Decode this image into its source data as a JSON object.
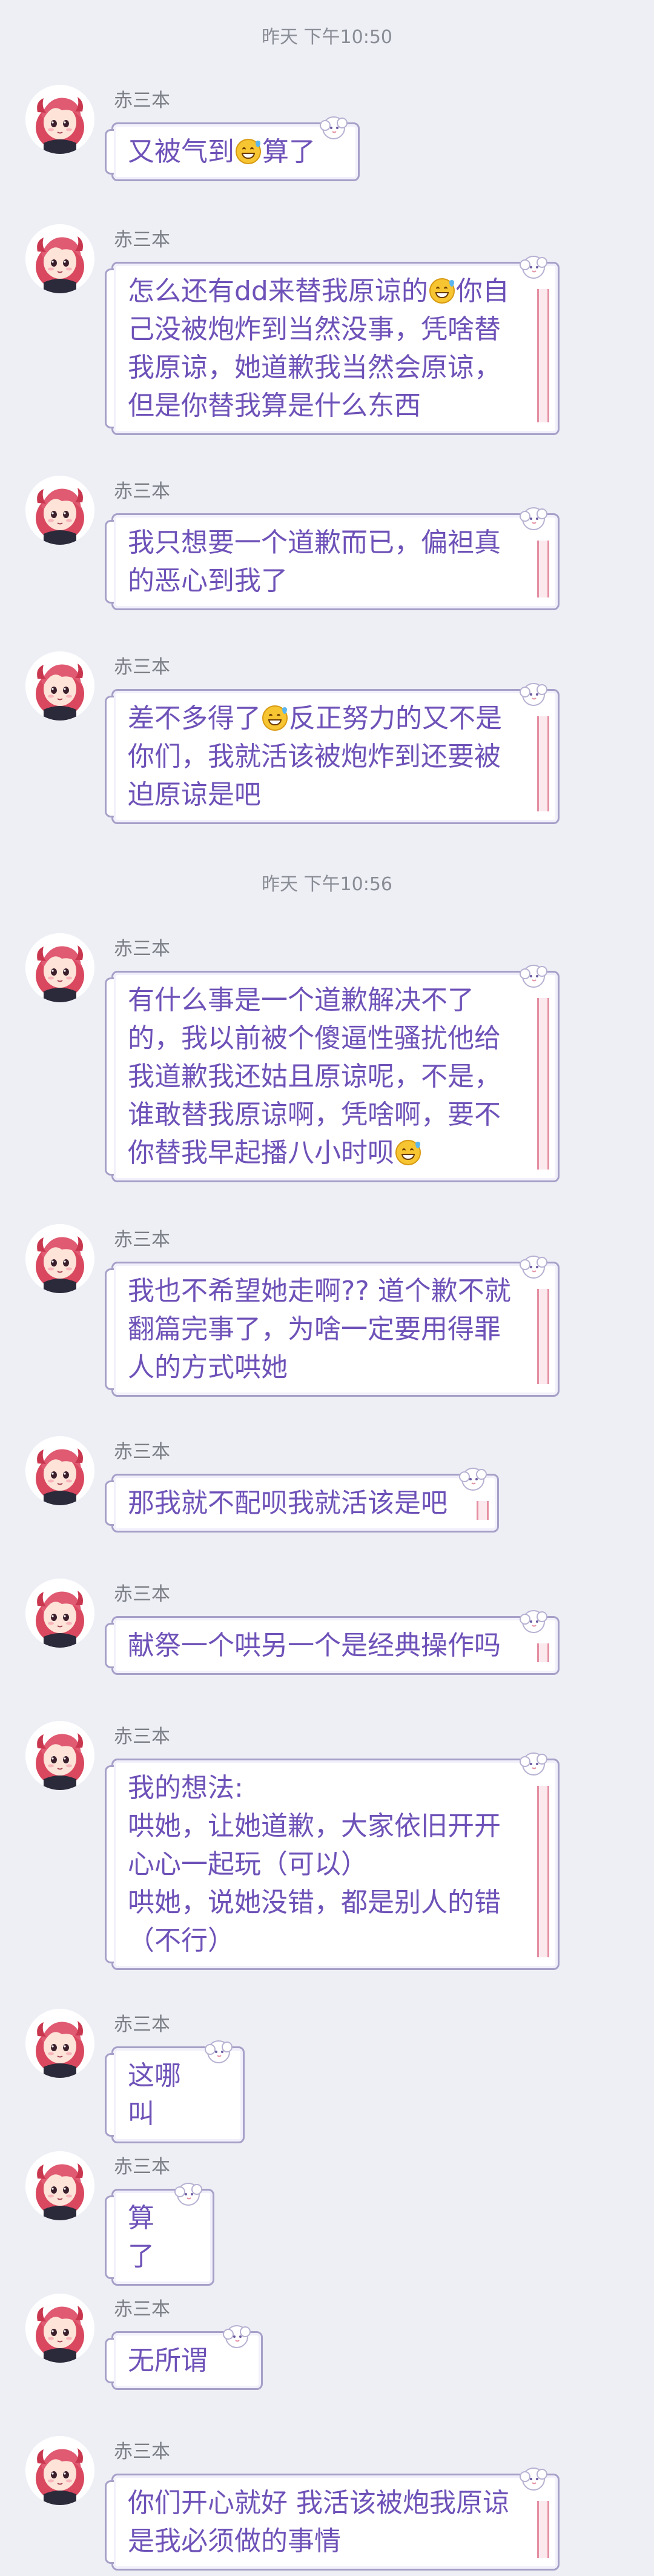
{
  "timestamps": [
    "昨天 下午10:50",
    "昨天 下午10:56"
  ],
  "sender": {
    "name": "赤三本",
    "avatar": "anime-girl-pink-hair-avatar"
  },
  "messages": [
    {
      "parts": [
        "又被气到",
        "😅",
        "算了"
      ]
    },
    {
      "parts": [
        "怎么还有dd来替我原谅的",
        "😅",
        "你自己没被炮炸到当然没事，凭啥替我原谅，她道歉我当然会原谅，但是你替我算是什么东西"
      ]
    },
    {
      "parts": [
        "我只想要一个道歉而已，偏袒真的恶心到我了"
      ]
    },
    {
      "parts": [
        "差不多得了",
        "😅",
        "反正努力的又不是你们，我就活该被炮炸到还要被迫原谅是吧"
      ]
    },
    {
      "parts": [
        "有什么事是一个道歉解决不了的，我以前被个傻逼性骚扰他给我道歉我还姑且原谅呢，不是，谁敢替我原谅啊，凭啥啊，要不你替我早起播八小时呗",
        "😅"
      ]
    },
    {
      "parts": [
        "我也不希望她走啊?? 道个歉不就翻篇完事了，为啥一定要用得罪人的方式哄她"
      ]
    },
    {
      "parts": [
        "那我就不配呗我就活该是吧"
      ]
    },
    {
      "parts": [
        "献祭一个哄另一个是经典操作吗"
      ]
    },
    {
      "parts": [
        "我的想法:\n哄她，让她道歉，大家依旧开开心心一起玩（可以）\n哄她，说她没错，都是别人的错（不行）"
      ]
    },
    {
      "parts": [
        "这哪叫"
      ]
    },
    {
      "parts": [
        "算了"
      ]
    },
    {
      "parts": [
        "无所谓"
      ]
    },
    {
      "parts": [
        "你们开心就好 我活该被炮我原谅是我必须做的事情"
      ]
    }
  ],
  "colors": {
    "background": "#edeff5",
    "bubble_text": "#6e52b8",
    "bubble_border": "#a6a0c8",
    "name_text": "#7c7f86"
  }
}
